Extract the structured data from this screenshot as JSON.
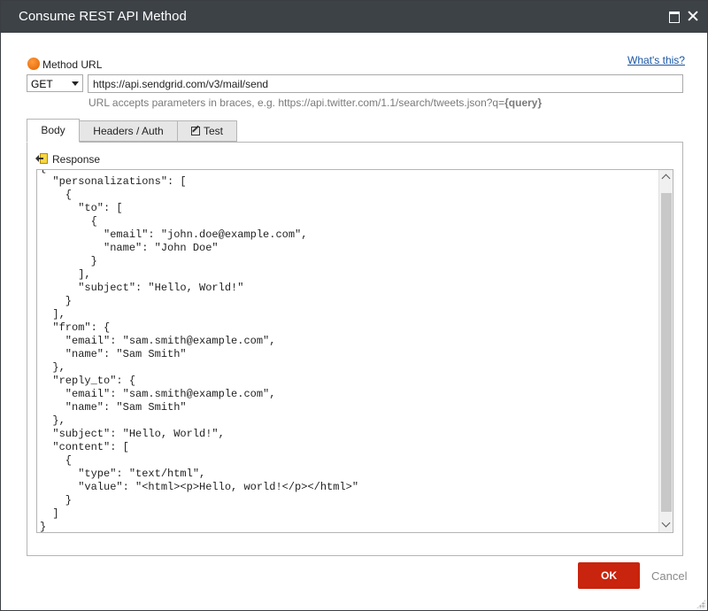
{
  "window": {
    "title": "Consume REST API Method"
  },
  "header": {
    "whats_this": "What's this?"
  },
  "method": {
    "label": "Method URL",
    "selected": "GET",
    "url": "https://api.sendgrid.com/v3/mail/send",
    "hint_prefix": "URL accepts parameters in braces, e.g. https://api.twitter.com/1.1/search/tweets.json?q=",
    "hint_param": "{query}"
  },
  "tabs": [
    {
      "label": "Body"
    },
    {
      "label": "Headers / Auth"
    },
    {
      "label": "Test"
    }
  ],
  "body": {
    "response_label": "Response",
    "code": "{\n  \"personalizations\": [\n    {\n      \"to\": [\n        {\n          \"email\": \"john.doe@example.com\",\n          \"name\": \"John Doe\"\n        }\n      ],\n      \"subject\": \"Hello, World!\"\n    }\n  ],\n  \"from\": {\n    \"email\": \"sam.smith@example.com\",\n    \"name\": \"Sam Smith\"\n  },\n  \"reply_to\": {\n    \"email\": \"sam.smith@example.com\",\n    \"name\": \"Sam Smith\"\n  },\n  \"subject\": \"Hello, World!\",\n  \"content\": [\n    {\n      \"type\": \"text/html\",\n      \"value\": \"<html><p>Hello, world!</p></html>\"\n    }\n  ]\n}"
  },
  "footer": {
    "ok_label": "OK",
    "cancel_label": "Cancel"
  },
  "colors": {
    "titlebar": "#3d4247",
    "ok_button": "#c9240d",
    "link": "#1a56a6",
    "method_dot": "#f07818"
  }
}
